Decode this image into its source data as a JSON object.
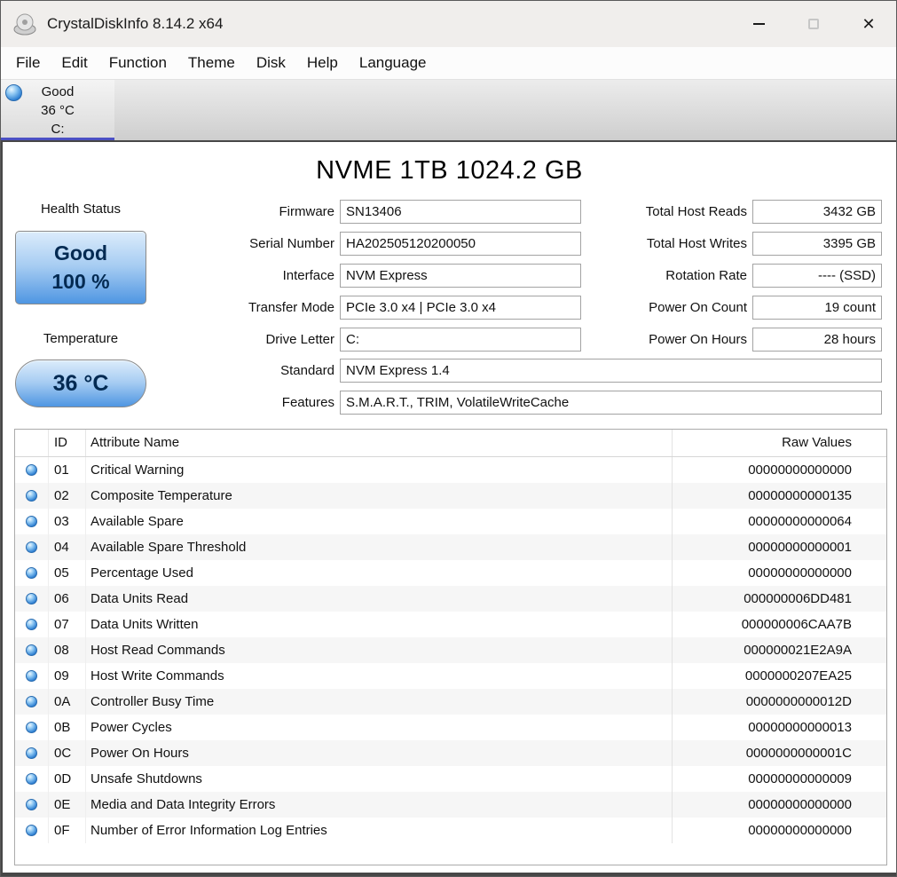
{
  "window": {
    "title": "CrystalDiskInfo 8.14.2 x64",
    "controls": {
      "close": "✕"
    }
  },
  "menu": {
    "items": [
      {
        "label": "File"
      },
      {
        "label": "Edit"
      },
      {
        "label": "Function"
      },
      {
        "label": "Theme"
      },
      {
        "label": "Disk"
      },
      {
        "label": "Help"
      },
      {
        "label": "Language"
      }
    ]
  },
  "drive_tabs": [
    {
      "status": "Good",
      "temp": "36 °C",
      "letter": "C:"
    }
  ],
  "drive": {
    "title": "NVME 1TB 1024.2 GB",
    "health": {
      "label": "Health Status",
      "status": "Good",
      "percent": "100 %"
    },
    "temperature": {
      "label": "Temperature",
      "value": "36 °C"
    },
    "info_left": [
      {
        "label": "Firmware",
        "value": "SN13406"
      },
      {
        "label": "Serial Number",
        "value": "HA202505120200050"
      },
      {
        "label": "Interface",
        "value": "NVM Express"
      },
      {
        "label": "Transfer Mode",
        "value": "PCIe 3.0 x4 | PCIe 3.0 x4"
      },
      {
        "label": "Drive Letter",
        "value": "C:"
      }
    ],
    "info_wide": [
      {
        "label": "Standard",
        "value": "NVM Express 1.4"
      },
      {
        "label": "Features",
        "value": "S.M.A.R.T., TRIM, VolatileWriteCache"
      }
    ],
    "info_right": [
      {
        "label": "Total Host Reads",
        "value": "3432 GB"
      },
      {
        "label": "Total Host Writes",
        "value": "3395 GB"
      },
      {
        "label": "Rotation Rate",
        "value": "---- (SSD)"
      },
      {
        "label": "Power On Count",
        "value": "19 count"
      },
      {
        "label": "Power On Hours",
        "value": "28 hours"
      }
    ]
  },
  "smart": {
    "headers": {
      "id": "ID",
      "name": "Attribute Name",
      "raw": "Raw Values"
    },
    "rows": [
      {
        "id": "01",
        "name": "Critical Warning",
        "raw": "00000000000000"
      },
      {
        "id": "02",
        "name": "Composite Temperature",
        "raw": "00000000000135"
      },
      {
        "id": "03",
        "name": "Available Spare",
        "raw": "00000000000064"
      },
      {
        "id": "04",
        "name": "Available Spare Threshold",
        "raw": "00000000000001"
      },
      {
        "id": "05",
        "name": "Percentage Used",
        "raw": "00000000000000"
      },
      {
        "id": "06",
        "name": "Data Units Read",
        "raw": "000000006DD481"
      },
      {
        "id": "07",
        "name": "Data Units Written",
        "raw": "000000006CAA7B"
      },
      {
        "id": "08",
        "name": "Host Read Commands",
        "raw": "000000021E2A9A"
      },
      {
        "id": "09",
        "name": "Host Write Commands",
        "raw": "0000000207EA25"
      },
      {
        "id": "0A",
        "name": "Controller Busy Time",
        "raw": "0000000000012D"
      },
      {
        "id": "0B",
        "name": "Power Cycles",
        "raw": "00000000000013"
      },
      {
        "id": "0C",
        "name": "Power On Hours",
        "raw": "0000000000001C"
      },
      {
        "id": "0D",
        "name": "Unsafe Shutdowns",
        "raw": "00000000000009"
      },
      {
        "id": "0E",
        "name": "Media and Data Integrity Errors",
        "raw": "00000000000000"
      },
      {
        "id": "0F",
        "name": "Number of Error Information Log Entries",
        "raw": "00000000000000"
      }
    ]
  }
}
